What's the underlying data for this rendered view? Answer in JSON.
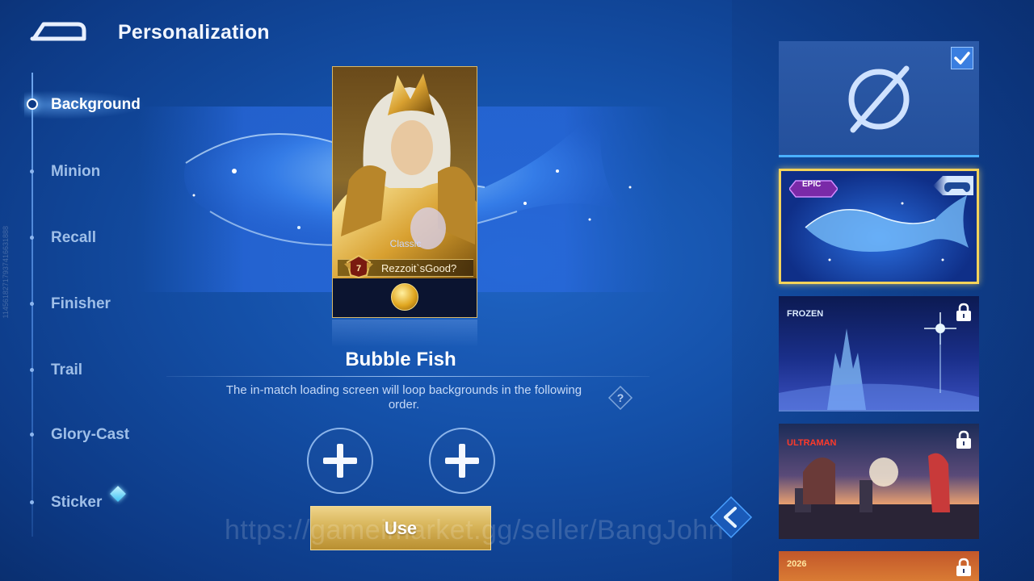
{
  "header": {
    "title": "Personalization"
  },
  "nav": {
    "items": [
      {
        "label": "Background",
        "active": true
      },
      {
        "label": "Minion",
        "active": false
      },
      {
        "label": "Recall",
        "active": false
      },
      {
        "label": "Finisher",
        "active": false
      },
      {
        "label": "Trail",
        "active": false
      },
      {
        "label": "Glory-Cast",
        "active": false
      },
      {
        "label": "Sticker",
        "active": false,
        "badge": "diamond"
      }
    ]
  },
  "preview": {
    "skin_label": "Classic",
    "player_name": "Rezzoit`sGood?",
    "rank_level": "7"
  },
  "selected_background": {
    "name": "Bubble Fish",
    "info": "The in-match loading screen will loop backgrounds in the following order.",
    "help_label": "?"
  },
  "slots": [
    {
      "icon": "plus-icon"
    },
    {
      "icon": "plus-icon"
    }
  ],
  "use_button": {
    "label": "Use"
  },
  "watermark": "https://gameimarket.gg/seller/BangJohn",
  "side_id": "11456182717937416631888",
  "backgrounds": [
    {
      "type": "none",
      "checked": true,
      "icon": "none-icon"
    },
    {
      "type": "whale",
      "selected": true,
      "rarity": "EPIC",
      "icon": "controller-icon"
    },
    {
      "type": "frozen",
      "locked": true,
      "brand": "FROZEN"
    },
    {
      "type": "ultraman",
      "locked": true,
      "brand": "ULTRAMAN"
    },
    {
      "type": "newyear",
      "locked": true,
      "brand": "2026"
    }
  ],
  "colors": {
    "accent": "#4ab0ff",
    "gold": "#f4d35a",
    "bg": "#1450a8"
  }
}
